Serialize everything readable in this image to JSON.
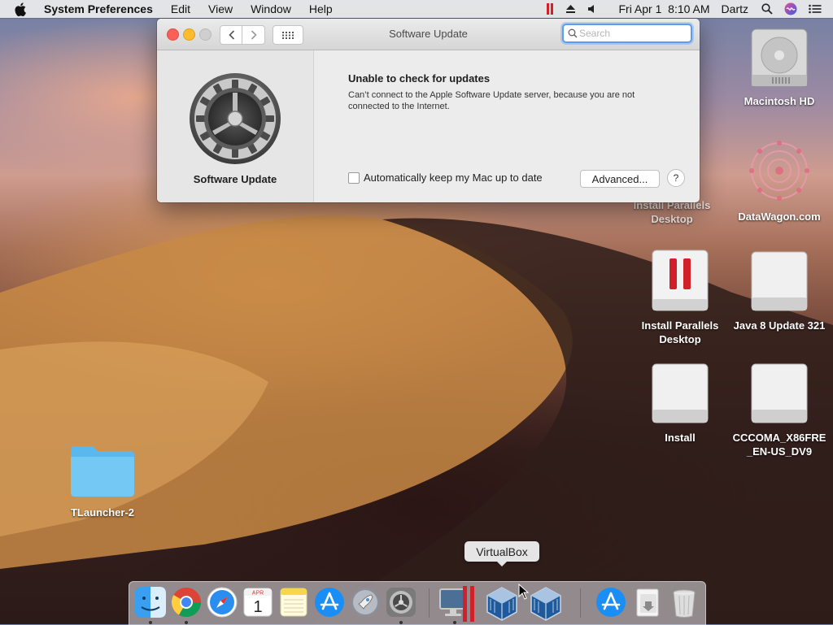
{
  "menubar": {
    "app_name": "System Preferences",
    "menus": [
      "Edit",
      "View",
      "Window",
      "Help"
    ],
    "datetime": "Fri Apr 1  8:10 AM",
    "user": "Dartz"
  },
  "window": {
    "title": "Software Update",
    "search_placeholder": "Search",
    "pane_label": "Software Update",
    "message_title": "Unable to check for updates",
    "message_body": "Can’t connect to the Apple Software Update server, because you are not connected to the Internet.",
    "auto_update_label": "Automatically keep my Mac up to date",
    "auto_update_checked": false,
    "advanced_label": "Advanced...",
    "help_label": "?"
  },
  "desktop": {
    "icons": [
      {
        "label": "Macintosh HD",
        "icon": "hard-drive-icon"
      },
      {
        "label": "Install Parallels Desktop",
        "icon": "parallels-installer-icon"
      },
      {
        "label": "DataWagon.com",
        "icon": "datawagon-icon"
      },
      {
        "label": "Install Parallels Desktop",
        "icon": "parallels-disk-icon"
      },
      {
        "label": "Java 8 Update 321",
        "icon": "external-drive-icon"
      },
      {
        "label": "Install",
        "icon": "external-drive-icon"
      },
      {
        "label": "CCCOMA_X86FRE_EN-US_DV9",
        "icon": "external-drive-icon"
      },
      {
        "label": "TLauncher-2",
        "icon": "folder-icon"
      }
    ]
  },
  "dock": {
    "tooltip": "VirtualBox",
    "calendar_month": "APR",
    "calendar_day": "1",
    "items": [
      "finder-icon",
      "chrome-icon",
      "safari-icon",
      "calendar-icon",
      "notes-icon",
      "app-store-icon",
      "launchpad-icon",
      "system-preferences-icon",
      "parallels-icon",
      "virtualbox-icon",
      "virtualbox-icon",
      "app-store-icon",
      "downloads-icon",
      "trash-icon"
    ]
  },
  "colors": {
    "accent": "#5e9ced",
    "close": "#fc5f57",
    "minimize": "#fdbc2e",
    "parallels_red": "#d0202a"
  }
}
